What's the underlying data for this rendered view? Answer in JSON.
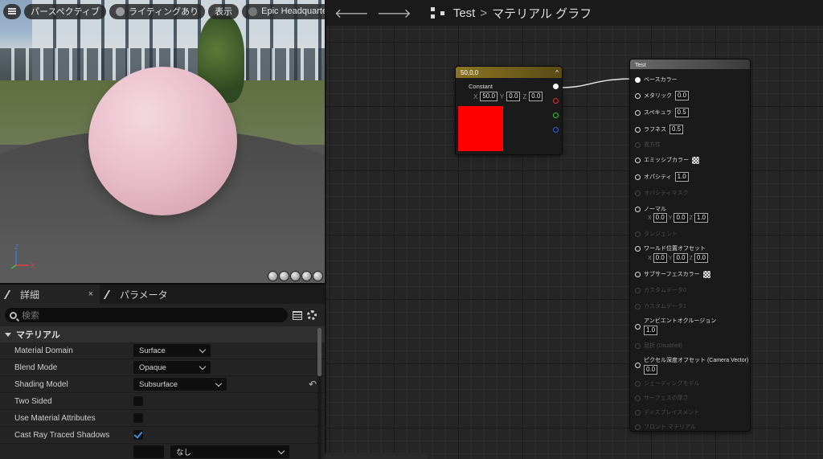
{
  "viewport": {
    "buttons": [
      "パースペクティブ",
      "ライティングあり",
      "表示",
      "Epic Headquarters"
    ],
    "axis": {
      "z": "Z",
      "x": "X"
    }
  },
  "details": {
    "tabs": [
      {
        "label": "詳細",
        "close": "×"
      },
      {
        "label": "パラメータ"
      }
    ],
    "search_placeholder": "検索",
    "category": "マテリアル",
    "rows": [
      {
        "label": "Material Domain",
        "value": "Surface"
      },
      {
        "label": "Blend Mode",
        "value": "Opaque"
      },
      {
        "label": "Shading Model",
        "value": "Subsurface",
        "reset": "↶"
      },
      {
        "label": "Two Sided",
        "checked": false
      },
      {
        "label": "Use Material Attributes",
        "checked": false
      },
      {
        "label": "Cast Ray Traced Shadows",
        "checked": true
      },
      {
        "label": "",
        "value": "なし"
      }
    ]
  },
  "graph": {
    "crumb": {
      "asset": "Test",
      "sep": ">",
      "page": "マテリアル グラフ"
    },
    "constant_node": {
      "title": "50,0,0",
      "collapse": "^",
      "name": "Constant",
      "x_label": "X",
      "x": "50.0",
      "y_label": "Y",
      "y": "0.0",
      "z_label": "Z",
      "z": "0.0",
      "color": "#ff0000"
    },
    "material_node": {
      "title": "Test",
      "pins": [
        {
          "label": "ベースカラー",
          "active": true
        },
        {
          "label": "メタリック",
          "value": "0.0",
          "active": true
        },
        {
          "label": "スペキュラ",
          "value": "0.5",
          "active": true
        },
        {
          "label": "ラフネス",
          "value": "0.5",
          "active": true
        },
        {
          "label": "異方性",
          "active": false
        },
        {
          "label": "エミッシブカラー",
          "active": true
        },
        {
          "label": "オパシティ",
          "value": "1.0",
          "active": true
        },
        {
          "label": "オパシティマスク",
          "active": false
        },
        {
          "label": "ノーマル",
          "active": true,
          "x_label": "X",
          "x": "0.0",
          "y_label": "Y",
          "y": "0.0",
          "z_label": "Z",
          "z": "1.0"
        },
        {
          "label": "タンジェント",
          "active": false
        },
        {
          "label": "ワールド位置オフセット",
          "active": true,
          "x_label": "X",
          "x": "0.0",
          "y_label": "Y",
          "y": "0.0",
          "z_label": "Z",
          "z": "0.0"
        },
        {
          "label": "サブサーフェスカラー",
          "active": true
        },
        {
          "label": "カスタムデータ0",
          "active": false
        },
        {
          "label": "カスタムデータ1",
          "active": false
        },
        {
          "label": "アンビエントオクルージョン",
          "value": "1.0",
          "active": true
        },
        {
          "label": "屈折 (Disabled)",
          "active": false
        },
        {
          "label": "ピクセル深度オフセット (Camera Vector)",
          "value": "0.0",
          "active": true
        },
        {
          "label": "シェーディングモデル",
          "active": false
        },
        {
          "label": "サーフェスの厚さ",
          "active": false
        },
        {
          "label": "ディスプレイスメント",
          "active": false
        },
        {
          "label": "フロント マテリアル",
          "active": false
        }
      ]
    }
  }
}
